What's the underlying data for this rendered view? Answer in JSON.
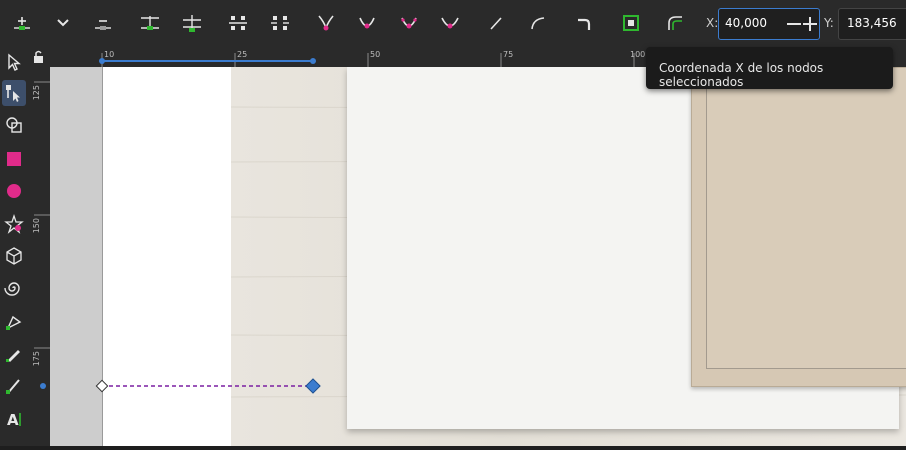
{
  "toolbar": {
    "buttons": [
      {
        "name": "insert-node-button",
        "icon": "insert-node-icon"
      },
      {
        "name": "insert-menu-button",
        "icon": "chevron-down-icon"
      },
      {
        "name": "delete-node-button",
        "icon": "delete-node-icon"
      },
      {
        "name": "join-nodes-button",
        "icon": "join-nodes-icon"
      },
      {
        "name": "break-path-button",
        "icon": "break-path-icon"
      },
      {
        "name": "join-segment-button",
        "icon": "join-segment-icon"
      },
      {
        "name": "delete-segment-button",
        "icon": "delete-segment-icon"
      },
      {
        "name": "node-cusp-button",
        "icon": "node-cusp-icon"
      },
      {
        "name": "node-smooth-button",
        "icon": "node-smooth-icon"
      },
      {
        "name": "node-symmetric-button",
        "icon": "node-symmetric-icon"
      },
      {
        "name": "node-auto-button",
        "icon": "node-auto-icon"
      },
      {
        "name": "segment-line-button",
        "icon": "segment-line-icon"
      },
      {
        "name": "segment-curve-button",
        "icon": "segment-curve-icon"
      },
      {
        "name": "object-to-path-button",
        "icon": "object-to-path-icon"
      },
      {
        "name": "stroke-to-path-button",
        "icon": "stroke-to-path-icon"
      },
      {
        "name": "show-handles-button",
        "icon": "show-handles-icon"
      }
    ],
    "x_label": "X:",
    "x_value": "40,000",
    "y_label": "Y:",
    "y_value": "183,456"
  },
  "tools": [
    {
      "name": "selector-tool",
      "icon": "arrow-icon",
      "active": false
    },
    {
      "name": "node-tool",
      "icon": "node-edit-icon",
      "active": true
    },
    {
      "name": "shape-builder-tool",
      "icon": "shape-builder-icon",
      "active": false
    },
    {
      "name": "rectangle-tool",
      "icon": "rectangle-icon",
      "active": false
    },
    {
      "name": "ellipse-tool",
      "icon": "circle-icon",
      "active": false
    },
    {
      "name": "star-tool",
      "icon": "star-icon",
      "active": false
    },
    {
      "name": "3d-box-tool",
      "icon": "cube-icon",
      "active": false
    },
    {
      "name": "spiral-tool",
      "icon": "spiral-icon",
      "active": false
    },
    {
      "name": "pen-tool",
      "icon": "pen-icon",
      "active": false
    },
    {
      "name": "pencil-tool",
      "icon": "pencil-icon",
      "active": false
    },
    {
      "name": "calligraphy-tool",
      "icon": "calligraphy-icon",
      "active": false
    },
    {
      "name": "text-tool",
      "icon": "text-icon",
      "active": false
    }
  ],
  "ruler": {
    "h_labels": [
      "10",
      "25",
      "50",
      "75",
      "100"
    ],
    "v_labels": [
      "125",
      "150",
      "175"
    ]
  },
  "tooltip": {
    "text": "Coordenada X de los nodos seleccionados"
  },
  "colors": {
    "accent": "#3b7ccf",
    "path": "#7a1fa2",
    "node_green": "#2fb82f",
    "node_pink": "#e02b8a"
  }
}
